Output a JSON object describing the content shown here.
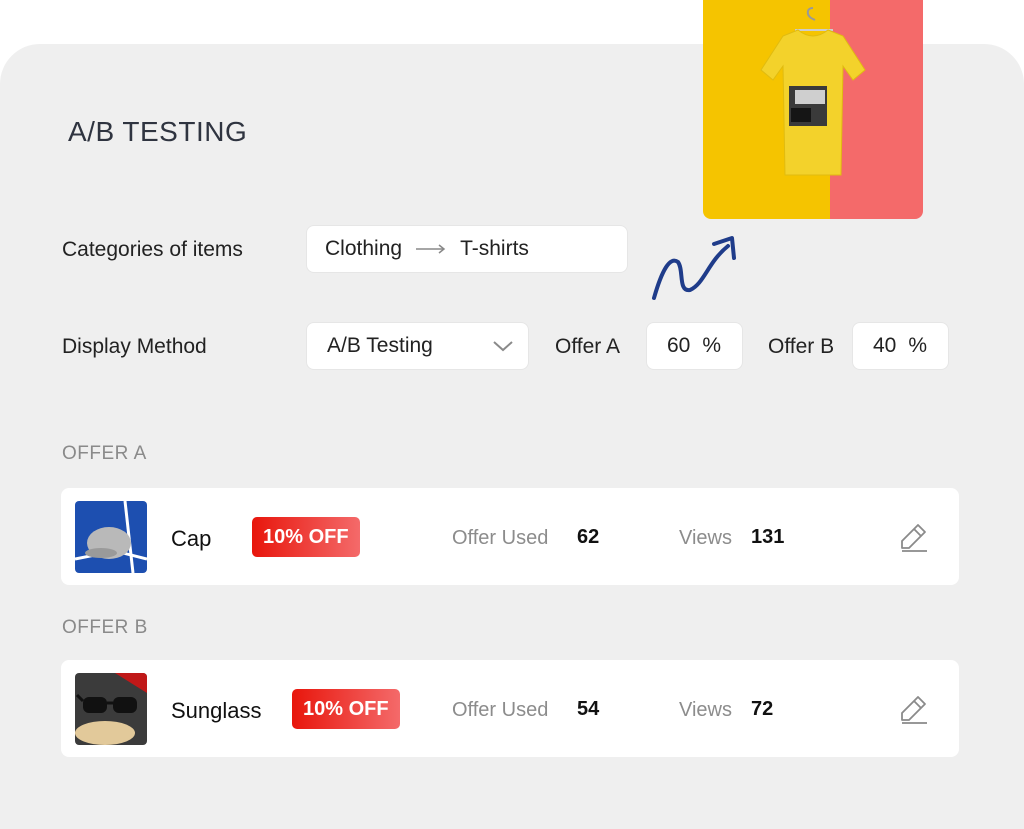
{
  "page": {
    "title": "A/B TESTING"
  },
  "categories": {
    "label": "Categories of items",
    "from": "Clothing",
    "to": "T-shirts"
  },
  "display": {
    "label": "Display Method",
    "method": "A/B Testing",
    "offer_a_label": "Offer A",
    "offer_a_value": "60",
    "offer_b_label": "Offer B",
    "offer_b_value": "40",
    "percent": "%"
  },
  "offers": [
    {
      "section_label": "OFFER A",
      "product": "Cap",
      "badge": "10% OFF",
      "used_label": "Offer Used",
      "used": "62",
      "views_label": "Views",
      "views": "131"
    },
    {
      "section_label": "OFFER B",
      "product": "Sunglass",
      "badge": "10% OFF",
      "used_label": "Offer Used",
      "used": "54",
      "views_label": "Views",
      "views": "72"
    }
  ],
  "colors": {
    "badge_red": "#e8160c",
    "shirt_yellow": "#f5c400",
    "bg_pink": "#f46a6a",
    "arrow_blue": "#1f3c8a"
  }
}
